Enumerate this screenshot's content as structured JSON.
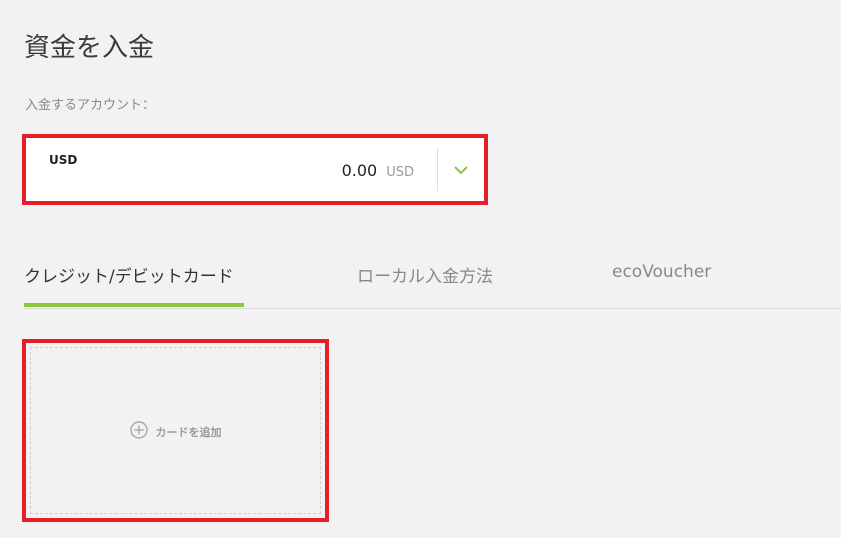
{
  "page": {
    "title": "資金を入金"
  },
  "account": {
    "label": "入金するアカウント：",
    "currency": "USD",
    "balance": "0.00",
    "balance_unit": "USD"
  },
  "tabs": [
    {
      "label": "クレジット/デビットカード",
      "active": true
    },
    {
      "label": "ローカル入金方法",
      "active": false
    },
    {
      "label": "ecoVoucher",
      "active": false
    }
  ],
  "add_card": {
    "label": "カードを追加"
  },
  "colors": {
    "accent_green": "#8cc63f",
    "highlight_red": "#e2202a",
    "background": "#f2f2f4"
  },
  "icons": {
    "dropdown": "chevron-down-icon",
    "add": "plus-circle-icon"
  }
}
